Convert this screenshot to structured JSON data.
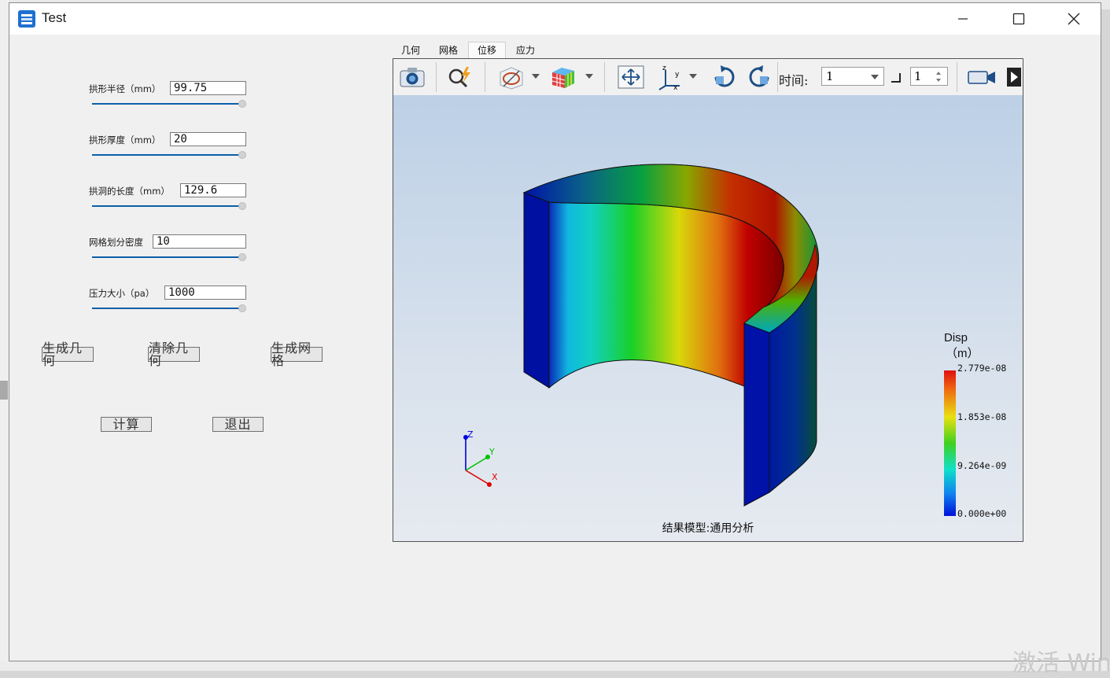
{
  "window": {
    "title": "Test"
  },
  "params": [
    {
      "label": "拱形半径（mm）",
      "value": "99.75"
    },
    {
      "label": "拱形厚度（mm）",
      "value": "20"
    },
    {
      "label": "拱洞的长度（mm）",
      "value": "129.6"
    },
    {
      "label": "网格划分密度",
      "value": "10"
    },
    {
      "label": "压力大小（pa）",
      "value": "1000"
    }
  ],
  "buttons": {
    "gen_geom": "生成几何",
    "clear_geom": "清除几何",
    "gen_mesh": "生成网格",
    "compute": "计算",
    "exit": "退出"
  },
  "tabs": [
    "几何",
    "网格",
    "位移",
    "应力"
  ],
  "active_tab": "位移",
  "toolbar": {
    "time_label": "时间:",
    "time_value": "1",
    "step_value": "1"
  },
  "viewer": {
    "caption": "结果模型:通用分析",
    "legend": {
      "title": "Disp",
      "unit": "（m）",
      "ticks": [
        "2.779e-08",
        "1.853e-08",
        "9.264e-09",
        "0.000e+00"
      ]
    },
    "axes": {
      "z": "Z",
      "y": "Y",
      "x": "X"
    }
  },
  "watermark": "激活 Win"
}
